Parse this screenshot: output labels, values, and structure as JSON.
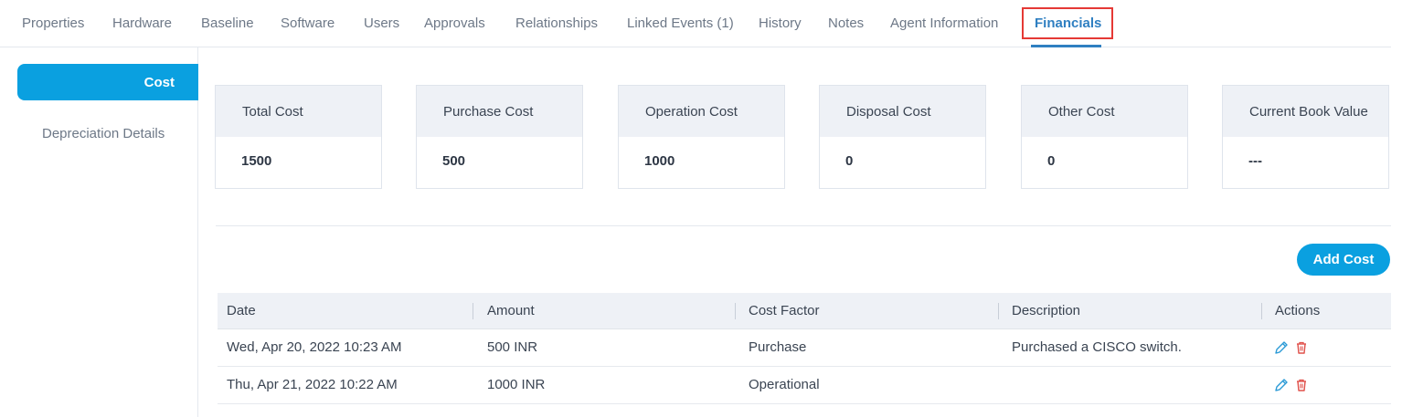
{
  "tabs": [
    {
      "label": "Properties"
    },
    {
      "label": "Hardware"
    },
    {
      "label": "Baseline"
    },
    {
      "label": "Software"
    },
    {
      "label": "Users"
    },
    {
      "label": "Approvals"
    },
    {
      "label": "Relationships"
    },
    {
      "label": "Linked Events (1)"
    },
    {
      "label": "History"
    },
    {
      "label": "Notes"
    },
    {
      "label": "Agent Information"
    },
    {
      "label": "Financials"
    }
  ],
  "sidebar": {
    "items": [
      {
        "label": "Cost"
      },
      {
        "label": "Depreciation Details"
      }
    ]
  },
  "cards": [
    {
      "title": "Total Cost",
      "value": "1500"
    },
    {
      "title": "Purchase Cost",
      "value": "500"
    },
    {
      "title": "Operation Cost",
      "value": "1000"
    },
    {
      "title": "Disposal Cost",
      "value": "0"
    },
    {
      "title": "Other Cost",
      "value": "0"
    },
    {
      "title": "Current Book Value",
      "value": "---"
    }
  ],
  "toolbar": {
    "add_cost_label": "Add Cost"
  },
  "table": {
    "columns": [
      "Date",
      "Amount",
      "Cost Factor",
      "Description",
      "Actions"
    ],
    "rows": [
      {
        "date": "Wed, Apr 20, 2022 10:23 AM",
        "amount": "500 INR",
        "cost_factor": "Purchase",
        "description": "Purchased a CISCO switch."
      },
      {
        "date": "Thu, Apr 21, 2022 10:22 AM",
        "amount": "1000 INR",
        "cost_factor": "Operational",
        "description": ""
      }
    ]
  },
  "colors": {
    "accent": "#0aa0e0",
    "active_tab": "#2f7fc1",
    "highlight": "#e53935",
    "edit_icon": "#2b9ad6",
    "delete_icon": "#e0504a"
  },
  "icons": {
    "edit": "pencil-icon",
    "delete": "trash-icon"
  }
}
